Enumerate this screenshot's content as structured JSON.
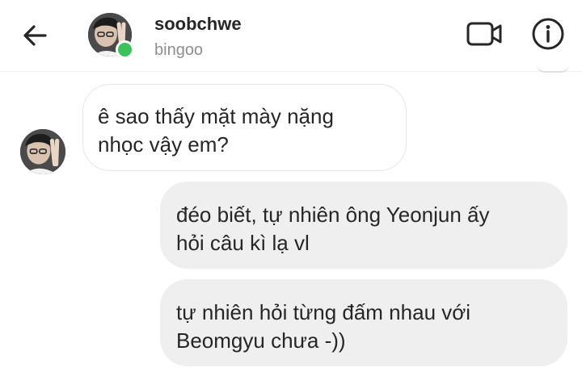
{
  "header": {
    "username": "soobchwe",
    "subtitle": "bingoo",
    "icons": {
      "back": "back-arrow-icon",
      "video": "video-camera-icon",
      "info": "info-icon"
    },
    "online_color": "#3ac35a"
  },
  "messages": [
    {
      "direction": "incoming",
      "lines": [
        "ê sao thấy mặt mày nặng",
        "nhọc vậy em?"
      ]
    },
    {
      "direction": "outgoing",
      "lines": [
        "đéo biết, tự nhiên ông Yeonjun ấy",
        "hỏi câu kì lạ vl"
      ]
    },
    {
      "direction": "outgoing",
      "lines": [
        "tự nhiên hỏi từng đấm nhau với",
        "Beomgyu chưa -))"
      ]
    }
  ],
  "colors": {
    "outgoing_bubble": "#efefef",
    "incoming_border": "#e6e6e6",
    "text": "#262626",
    "muted": "#8e8e8e"
  }
}
